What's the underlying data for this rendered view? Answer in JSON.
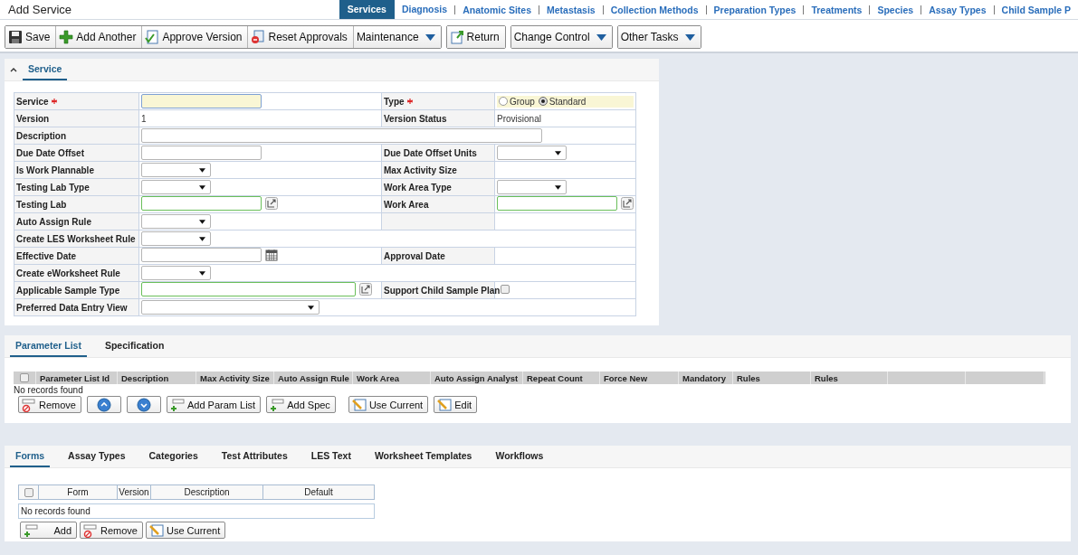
{
  "header": {
    "title": "Add Service",
    "nav": [
      {
        "label": "Services",
        "selected": true
      },
      {
        "label": "Diagnosis",
        "selected": false
      },
      {
        "label": "Anatomic Sites",
        "selected": false
      },
      {
        "label": "Metastasis",
        "selected": false
      },
      {
        "label": "Collection Methods",
        "selected": false
      },
      {
        "label": "Preparation Types",
        "selected": false
      },
      {
        "label": "Treatments",
        "selected": false
      },
      {
        "label": "Species",
        "selected": false
      },
      {
        "label": "Assay Types",
        "selected": false
      },
      {
        "label": "Child Sample P",
        "selected": false
      }
    ]
  },
  "toolbar": {
    "groups": [
      [
        {
          "label": "Save",
          "kind": "save"
        },
        {
          "label": "Add Another",
          "kind": "plus"
        },
        {
          "label": "Approve Version",
          "kind": "approve"
        },
        {
          "label": "Reset Approvals",
          "kind": "reset"
        },
        {
          "label": "Maintenance",
          "menu": true
        }
      ],
      [
        {
          "label": "Return",
          "kind": "return"
        }
      ],
      [
        {
          "label": "Change Control",
          "menu": true
        }
      ],
      [
        {
          "label": "Other Tasks",
          "menu": true
        }
      ]
    ]
  },
  "service_panel": {
    "tab": "Service",
    "expanded": true,
    "rows": [
      {
        "left": {
          "label": "Service",
          "required": true,
          "field": {
            "kind": "text"
          }
        },
        "right": {
          "label": "Type",
          "required": true,
          "field": {
            "kind": "radios",
            "options": [
              {
                "label": "Group",
                "selected": false
              },
              {
                "label": "Standard",
                "selected": true
              }
            ]
          }
        }
      },
      {
        "left": {
          "label": "Version",
          "field": {
            "kind": "value",
            "value": "1"
          }
        },
        "right": {
          "label": "Version Status",
          "field": {
            "kind": "value",
            "value": "Provisional"
          }
        }
      },
      {
        "left": {
          "label": "Description",
          "field": {
            "kind": "wide-text"
          }
        }
      },
      {
        "left": {
          "label": "Due Date Offset",
          "field": {
            "kind": "text"
          }
        },
        "right": {
          "label": "Due Date Offset Units",
          "field": {
            "kind": "select"
          }
        }
      },
      {
        "left": {
          "label": "Is Work Plannable",
          "field": {
            "kind": "select"
          }
        },
        "right": {
          "label": "Max Activity Size",
          "field": {
            "kind": "none"
          }
        }
      },
      {
        "left": {
          "label": "Testing Lab Type",
          "field": {
            "kind": "select"
          }
        },
        "right": {
          "label": "Work Area Type",
          "field": {
            "kind": "select"
          }
        }
      },
      {
        "left": {
          "label": "Testing Lab",
          "field": {
            "kind": "lookup"
          }
        },
        "right": {
          "label": "Work Area",
          "field": {
            "kind": "lookup"
          }
        }
      },
      {
        "left": {
          "label": "Auto Assign Rule",
          "field": {
            "kind": "select"
          }
        },
        "right": {
          "field": {
            "kind": "none"
          }
        }
      },
      {
        "left": {
          "label": "Create LES Worksheet Rule",
          "field": {
            "kind": "select"
          }
        }
      },
      {
        "left": {
          "label": "Effective Date",
          "field": {
            "kind": "date"
          }
        },
        "right": {
          "label": "Approval Date",
          "field": {
            "kind": "none"
          }
        }
      },
      {
        "left": {
          "label": "Create eWorksheet Rule",
          "field": {
            "kind": "select"
          }
        }
      },
      {
        "left": {
          "label": "Applicable Sample Type",
          "field": {
            "kind": "wide-lookup"
          }
        },
        "right": {
          "label": "Support Child Sample Plan",
          "field": {
            "kind": "checkbox",
            "checked": false
          }
        }
      },
      {
        "left": {
          "label": "Preferred Data Entry View",
          "field": {
            "kind": "wide-select"
          }
        }
      }
    ]
  },
  "parameter_panel": {
    "tabs": [
      {
        "label": "Parameter List",
        "selected": true
      },
      {
        "label": "Specification",
        "selected": false
      }
    ],
    "grid": {
      "select_all": {
        "checked": false
      },
      "columns": [
        "Parameter List Id",
        "Description",
        "Max Activity Size",
        "Auto Assign Rule",
        "Work Area",
        "Auto Assign Analyst",
        "Repeat Count",
        "Force New",
        "Mandatory",
        "Rules",
        "Rules"
      ],
      "empty_text": "No records found"
    },
    "buttons": [
      {
        "label": "Remove",
        "kind": "remove"
      },
      {
        "kind": "up"
      },
      {
        "kind": "down"
      },
      {
        "label": "Add Param List",
        "kind": "add"
      },
      {
        "label": "Add Spec",
        "kind": "add"
      },
      {
        "label": "Use Current",
        "kind": "pencil"
      },
      {
        "label": "Edit",
        "kind": "pencil"
      }
    ]
  },
  "forms_panel": {
    "tabs": [
      {
        "label": "Forms",
        "selected": true
      },
      {
        "label": "Assay Types",
        "selected": false
      },
      {
        "label": "Categories",
        "selected": false
      },
      {
        "label": "Test Attributes",
        "selected": false
      },
      {
        "label": "LES Text",
        "selected": false
      },
      {
        "label": "Worksheet Templates",
        "selected": false
      },
      {
        "label": "Workflows",
        "selected": false
      }
    ],
    "grid": {
      "select_all": {
        "checked": false
      },
      "columns": [
        "Form",
        "Version",
        "Description",
        "Default"
      ],
      "empty_text": "No records found"
    },
    "buttons": [
      {
        "label": "Add",
        "kind": "add"
      },
      {
        "label": "Remove",
        "kind": "remove"
      },
      {
        "label": "Use Current",
        "kind": "pencil"
      }
    ]
  }
}
